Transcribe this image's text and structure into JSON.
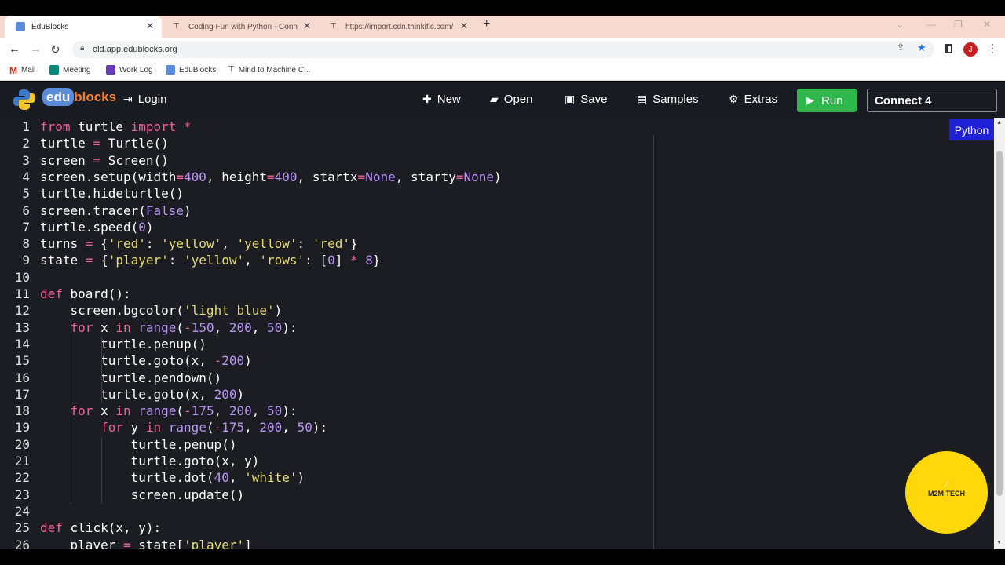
{
  "browser": {
    "tabs": [
      {
        "title": "EduBlocks",
        "active": true
      },
      {
        "title": "Coding Fun with Python - Conn",
        "active": false
      },
      {
        "title": "https://import.cdn.thinkific.com/",
        "active": false
      }
    ],
    "url": "old.app.edublocks.org",
    "profile_initial": "J",
    "bookmarks": [
      "Mail",
      "Meeting",
      "Work Log",
      "EduBlocks",
      "Mind to Machine C..."
    ]
  },
  "app": {
    "logo_edu": "edu",
    "logo_blocks": "blocks",
    "login": "Login",
    "new": "New",
    "open": "Open",
    "save": "Save",
    "samples": "Samples",
    "extras": "Extras",
    "run": "Run",
    "project_name": "Connect 4",
    "mode_tab": "Python"
  },
  "badge": {
    "text": "M2M TECH"
  },
  "colors": {
    "run": "#2eb84b",
    "python_tab": "#2020d6",
    "badge": "#ffd80c",
    "keyword": "#f0629a",
    "number": "#b894f5",
    "string": "#e6db74"
  },
  "code_lines": [
    "from turtle import *",
    "turtle = Turtle()",
    "screen = Screen()",
    "screen.setup(width=400, height=400, startx=None, starty=None)",
    "turtle.hideturtle()",
    "screen.tracer(False)",
    "turtle.speed(0)",
    "turns = {'red': 'yellow', 'yellow': 'red'}",
    "state = {'player': 'yellow', 'rows': [0] * 8}",
    "",
    "def board():",
    "    screen.bgcolor('light blue')",
    "    for x in range(-150, 200, 50):",
    "        turtle.penup()",
    "        turtle.goto(x, -200)",
    "        turtle.pendown()",
    "        turtle.goto(x, 200)",
    "    for x in range(-175, 200, 50):",
    "        for y in range(-175, 200, 50):",
    "            turtle.penup()",
    "            turtle.goto(x, y)",
    "            turtle.dot(40, 'white')",
    "            screen.update()",
    "",
    "def click(x, y):",
    "    player = state['player']"
  ]
}
